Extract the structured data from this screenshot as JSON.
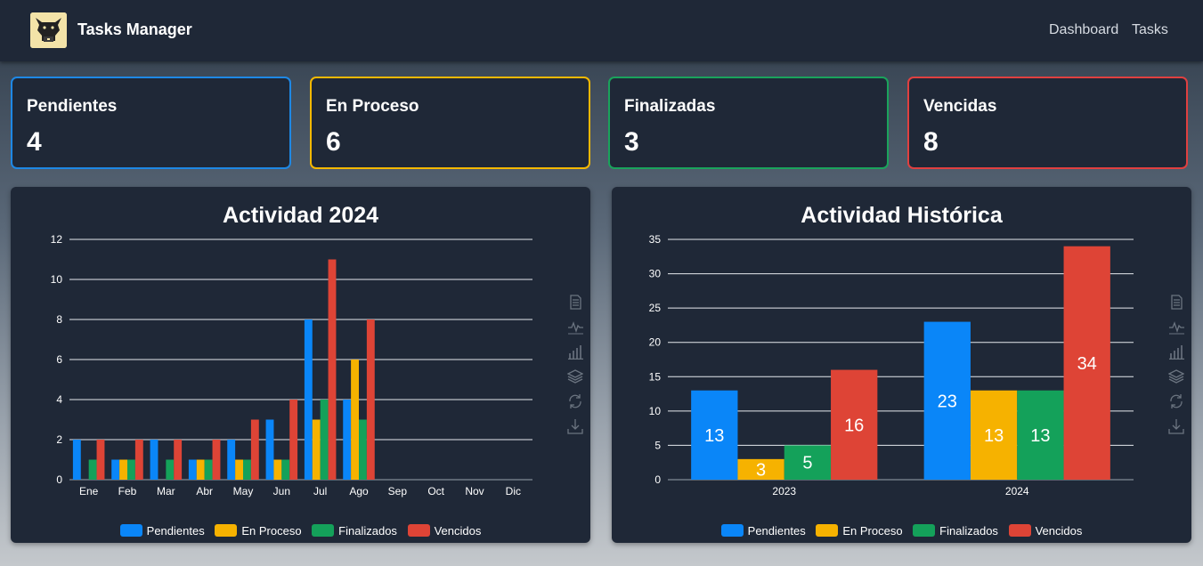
{
  "app": {
    "title": "Tasks Manager"
  },
  "nav": {
    "links": [
      "Dashboard",
      "Tasks"
    ]
  },
  "stats": [
    {
      "label": "Pendientes",
      "value": "4",
      "color": "#1e88e5"
    },
    {
      "label": "En Proceso",
      "value": "6",
      "color": "#f5b800"
    },
    {
      "label": "Finalizadas",
      "value": "3",
      "color": "#1aa35c"
    },
    {
      "label": "Vencidas",
      "value": "8",
      "color": "#e04040"
    }
  ],
  "colors": {
    "pendientes": "#0a86f8",
    "en_proceso": "#f6b200",
    "finalizados": "#14a15a",
    "vencidos": "#de4436",
    "card_bg": "#1f2837"
  },
  "toolbox_icons": [
    "data-view-icon",
    "line-chart-icon",
    "bar-chart-icon",
    "stack-icon",
    "restore-icon",
    "download-icon"
  ],
  "chart_data": [
    {
      "type": "bar",
      "title": "Actividad 2024",
      "categories": [
        "Ene",
        "Feb",
        "Mar",
        "Abr",
        "May",
        "Jun",
        "Jul",
        "Ago",
        "Sep",
        "Oct",
        "Nov",
        "Dic"
      ],
      "series": [
        {
          "name": "Pendientes",
          "values": [
            2,
            1,
            2,
            1,
            2,
            3,
            8,
            4,
            0,
            0,
            0,
            0
          ]
        },
        {
          "name": "En Proceso",
          "values": [
            0,
            1,
            0,
            1,
            1,
            1,
            3,
            6,
            0,
            0,
            0,
            0
          ]
        },
        {
          "name": "Finalizados",
          "values": [
            1,
            1,
            1,
            1,
            1,
            1,
            4,
            3,
            0,
            0,
            0,
            0
          ]
        },
        {
          "name": "Vencidos",
          "values": [
            2,
            2,
            2,
            2,
            3,
            4,
            11,
            8,
            0,
            0,
            0,
            0
          ]
        }
      ],
      "ylim": [
        0,
        12
      ],
      "yticks": [
        0,
        2,
        4,
        6,
        8,
        10,
        12
      ],
      "show_labels": false,
      "grid": true,
      "legend": "bottom"
    },
    {
      "type": "bar",
      "title": "Actividad Histórica",
      "categories": [
        "2023",
        "2024"
      ],
      "series": [
        {
          "name": "Pendientes",
          "values": [
            13,
            23
          ]
        },
        {
          "name": "En Proceso",
          "values": [
            3,
            13
          ]
        },
        {
          "name": "Finalizados",
          "values": [
            5,
            13
          ]
        },
        {
          "name": "Vencidos",
          "values": [
            16,
            34
          ]
        }
      ],
      "ylim": [
        0,
        35
      ],
      "yticks": [
        0,
        5,
        10,
        15,
        20,
        25,
        30,
        35
      ],
      "show_labels": true,
      "grid": true,
      "legend": "bottom"
    }
  ]
}
